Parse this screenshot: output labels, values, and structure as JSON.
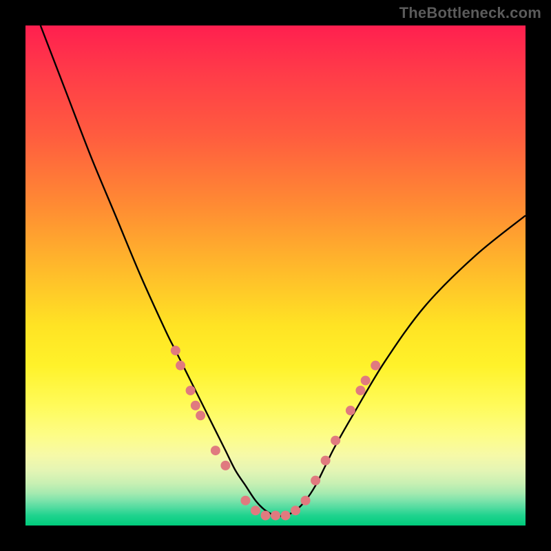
{
  "watermark": "TheBottleneck.com",
  "colors": {
    "background": "#000000",
    "curve": "#000000",
    "dots": "#e07a7f",
    "gradient_stops": [
      "#ff1f4f",
      "#ff3a49",
      "#ff5c3f",
      "#ff8b33",
      "#ffbf2a",
      "#ffe324",
      "#fff22a",
      "#fffb5a",
      "#fdfd87",
      "#f6f9a8",
      "#e4f5b4",
      "#c9f0b3",
      "#a6eab0",
      "#7de3ab",
      "#4fdb9f",
      "#1fd38e",
      "#00cc7c"
    ]
  },
  "chart_data": {
    "type": "line",
    "title": "",
    "xlabel": "",
    "ylabel": "",
    "xlim": [
      0,
      100
    ],
    "ylim": [
      0,
      100
    ],
    "grid": false,
    "series": [
      {
        "name": "bottleneck-curve",
        "x": [
          3,
          8,
          13,
          18,
          23,
          28,
          30,
          32,
          34,
          36,
          38,
          40,
          42,
          44,
          46,
          48,
          50,
          52,
          54,
          56,
          58,
          60,
          62,
          66,
          72,
          80,
          90,
          100
        ],
        "y": [
          100,
          87,
          74,
          62,
          50,
          39,
          35,
          31,
          27,
          23,
          19,
          15,
          11,
          8,
          5,
          3,
          2,
          2,
          3,
          5,
          8,
          12,
          16,
          23,
          33,
          44,
          54,
          62
        ]
      }
    ],
    "points": [
      {
        "name": "left-cluster",
        "x": 30,
        "y": 35
      },
      {
        "name": "left-cluster",
        "x": 31,
        "y": 32
      },
      {
        "name": "left-cluster",
        "x": 33,
        "y": 27
      },
      {
        "name": "left-cluster",
        "x": 34,
        "y": 24
      },
      {
        "name": "left-cluster",
        "x": 35,
        "y": 22
      },
      {
        "name": "left-cluster",
        "x": 38,
        "y": 15
      },
      {
        "name": "left-cluster",
        "x": 40,
        "y": 12
      },
      {
        "name": "bottom",
        "x": 44,
        "y": 5
      },
      {
        "name": "bottom",
        "x": 46,
        "y": 3
      },
      {
        "name": "bottom",
        "x": 48,
        "y": 2
      },
      {
        "name": "bottom",
        "x": 50,
        "y": 2
      },
      {
        "name": "bottom",
        "x": 52,
        "y": 2
      },
      {
        "name": "bottom",
        "x": 54,
        "y": 3
      },
      {
        "name": "bottom",
        "x": 56,
        "y": 5
      },
      {
        "name": "right-cluster",
        "x": 58,
        "y": 9
      },
      {
        "name": "right-cluster",
        "x": 60,
        "y": 13
      },
      {
        "name": "right-cluster",
        "x": 62,
        "y": 17
      },
      {
        "name": "right-cluster",
        "x": 65,
        "y": 23
      },
      {
        "name": "right-cluster",
        "x": 67,
        "y": 27
      },
      {
        "name": "right-cluster",
        "x": 68,
        "y": 29
      },
      {
        "name": "right-cluster",
        "x": 70,
        "y": 32
      }
    ]
  }
}
